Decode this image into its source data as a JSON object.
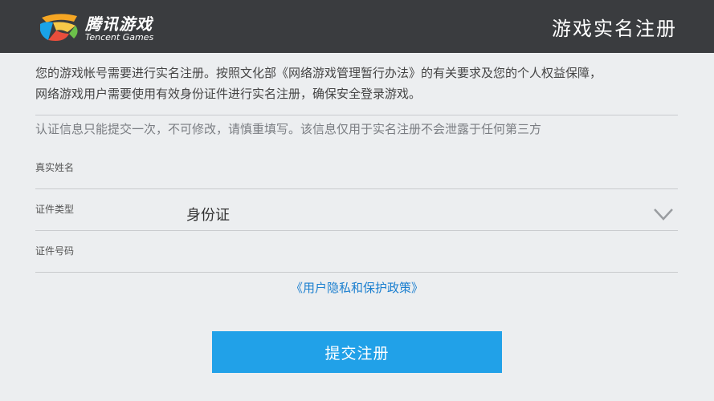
{
  "header": {
    "brand_cn": "腾讯游戏",
    "brand_en": "Tencent Games",
    "title": "游戏实名注册"
  },
  "notice": {
    "line1": "您的游戏帐号需要进行实名注册。按照文化部《网络游戏管理暂行办法》的有关要求及您的个人权益保障，",
    "line2": "网络游戏用户需要使用有效身份证件进行实名注册，确保安全登录游戏。"
  },
  "warning": "认证信息只能提交一次，不可修改，请慎重填写。该信息仅用于实名注册不会泄露于任何第三方",
  "form": {
    "name_label": "真实姓名",
    "name_value": "",
    "id_type_label": "证件类型",
    "id_type_value": "身份证",
    "id_number_label": "证件号码",
    "id_number_value": ""
  },
  "policy_link": "《用户隐私和保护政策》",
  "submit_label": "提交注册",
  "colors": {
    "header_bg": "#3a3c3f",
    "page_bg": "#eceef0",
    "link": "#1b7fcf",
    "button": "#21a1e8"
  },
  "icons": {
    "logo": "tencent-games-logo",
    "dropdown": "chevron-down-icon"
  }
}
